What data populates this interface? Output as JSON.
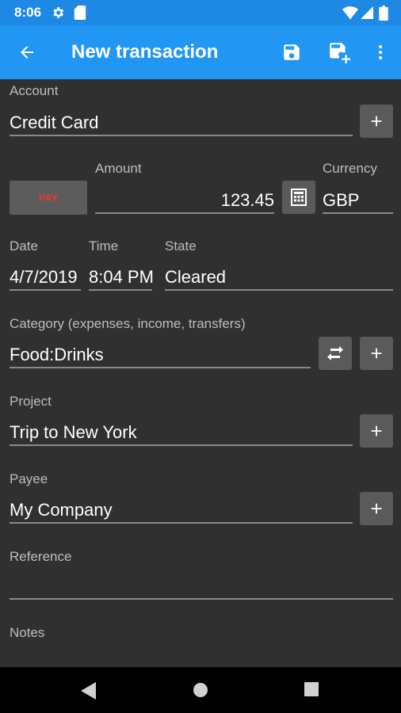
{
  "status_bar": {
    "time": "8:06",
    "icons": [
      "gear-icon",
      "sd-card-icon",
      "wifi-icon",
      "signal-icon",
      "battery-icon"
    ]
  },
  "app_bar": {
    "title": "New transaction",
    "color": "#2196f3",
    "icons": [
      "back-arrow-icon",
      "save-icon",
      "save-and-new-icon",
      "more-vert-icon"
    ]
  },
  "form": {
    "account": {
      "label": "Account",
      "value": "Credit Card"
    },
    "pay_button": {
      "label": "PAY",
      "color": "#e53935"
    },
    "amount": {
      "label": "Amount",
      "value": "123.45"
    },
    "currency": {
      "label": "Currency",
      "value": "GBP"
    },
    "date": {
      "label": "Date",
      "value": "4/7/2019"
    },
    "time": {
      "label": "Time",
      "value": "8:04 PM"
    },
    "state": {
      "label": "State",
      "value": "Cleared"
    },
    "category": {
      "label": "Category (expenses, income, transfers)",
      "value": "Food:Drinks"
    },
    "project": {
      "label": "Project",
      "value": "Trip to New York"
    },
    "payee": {
      "label": "Payee",
      "value": "My Company"
    },
    "reference": {
      "label": "Reference",
      "value": ""
    },
    "notes": {
      "label": "Notes",
      "value": ""
    }
  },
  "nav_bar": {
    "icons": [
      "back-triangle-icon",
      "home-circle-icon",
      "recents-square-icon"
    ]
  }
}
